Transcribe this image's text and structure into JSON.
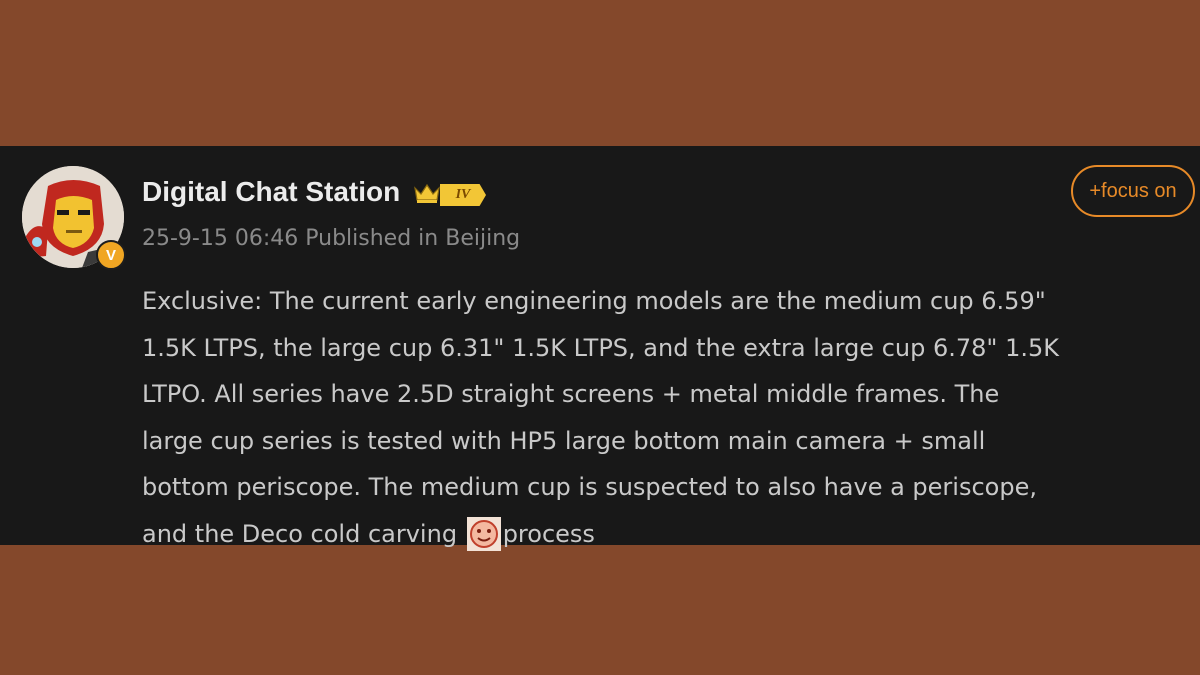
{
  "post": {
    "author": "Digital Chat Station",
    "level": "IV",
    "verified_badge": "V",
    "timestamp": "25-9-15 06:46",
    "location": "Published in Beijing",
    "follow_label": "+focus on",
    "body_lines": [
      "Exclusive: The current early engineering models are the medium cup 6.59\"",
      "1.5K LTPS, the large cup 6.31\" 1.5K LTPS, and the extra large cup 6.78\" 1.5K",
      "LTPO. All series have 2.5D straight screens + metal middle frames. The",
      "large cup series is tested with HP5 large bottom main camera + small",
      "bottom periscope. The medium cup is suspected to also have a periscope,",
      "and the Deco cold carving",
      "process"
    ]
  },
  "icons": {
    "avatar": "iron-man-avatar",
    "crown": "crown-icon",
    "emoji": "face-emoji"
  },
  "colors": {
    "background": "#84482b",
    "panel": "#181818",
    "accent": "#e78a28",
    "level_badge": "#f2c636",
    "verified": "#f0a623"
  }
}
